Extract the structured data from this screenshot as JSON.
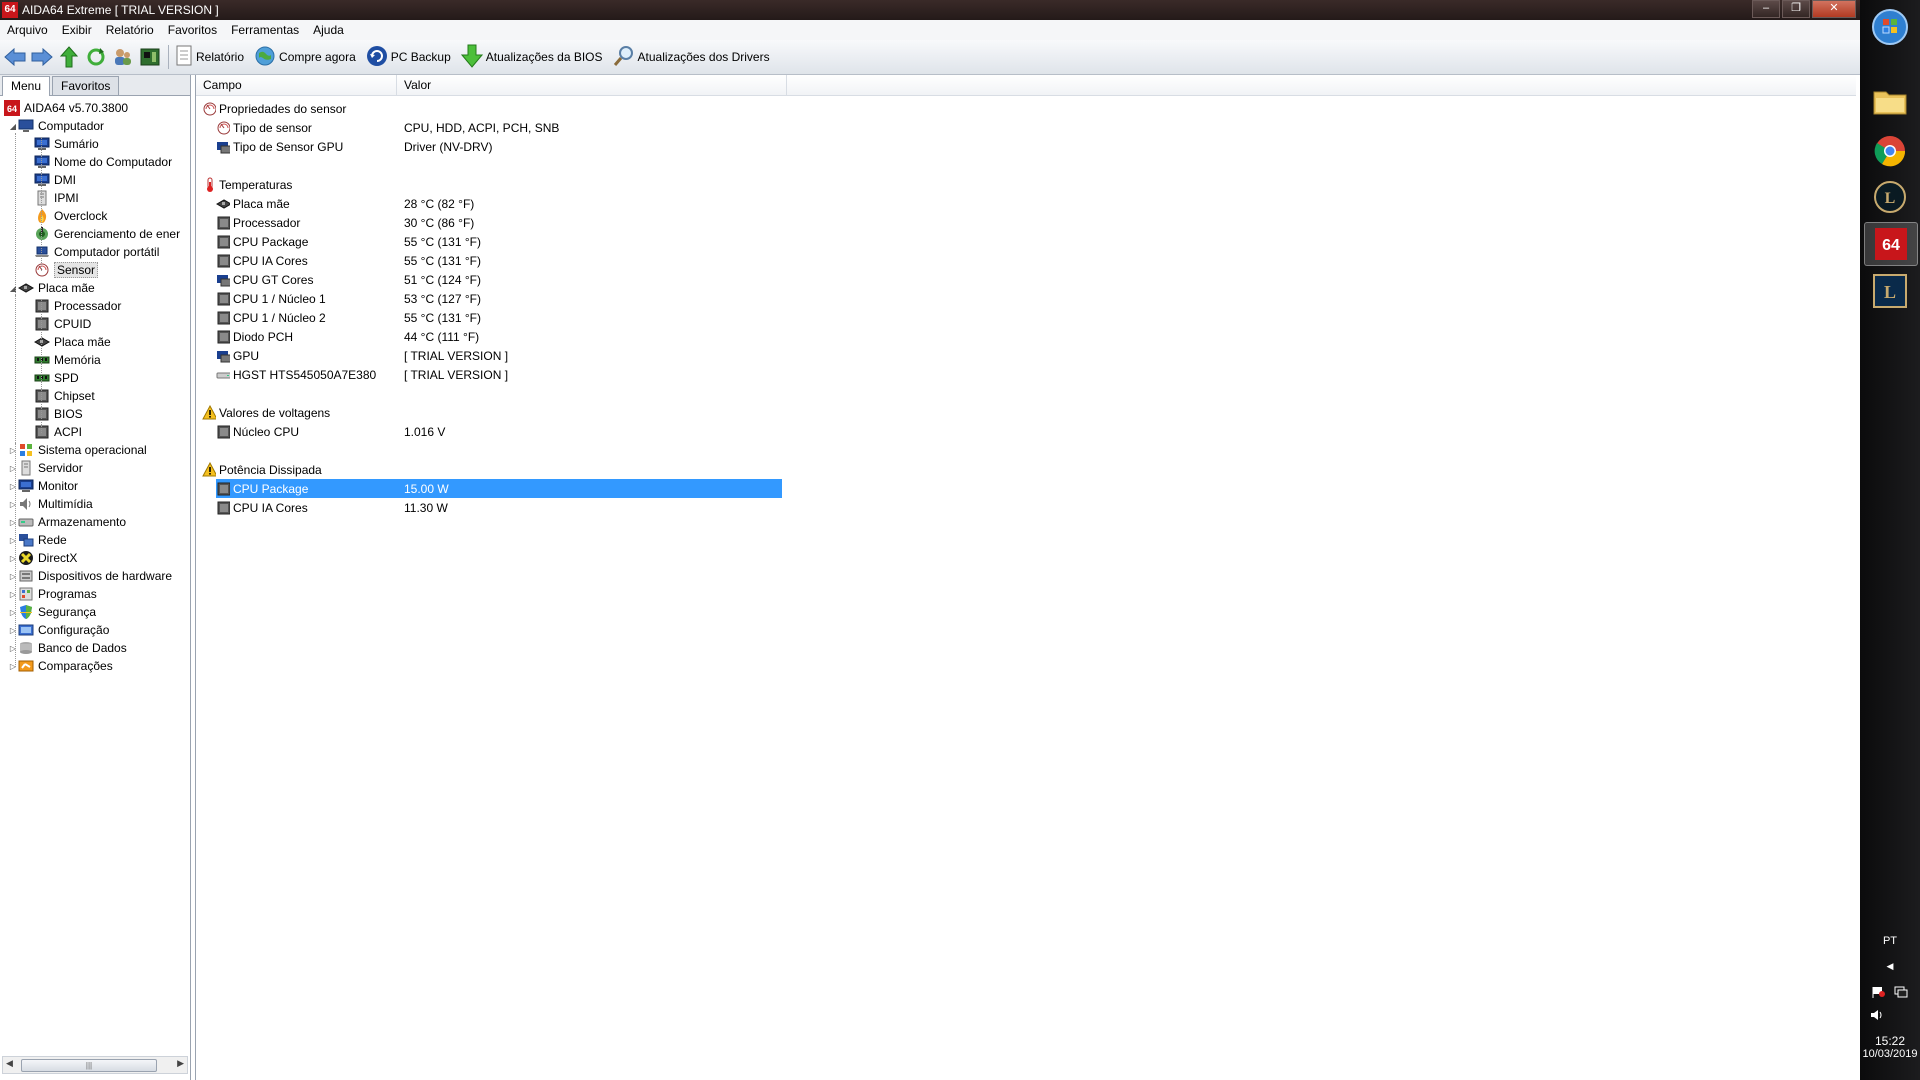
{
  "window": {
    "title": "AIDA64 Extreme  [ TRIAL VERSION ]",
    "app_icon_text": "64",
    "buttons": [
      "–",
      "❐",
      "✕"
    ]
  },
  "menubar": [
    "Arquivo",
    "Exibir",
    "Relatório",
    "Favoritos",
    "Ferramentas",
    "Ajuda"
  ],
  "toolbar": {
    "buttons": [
      {
        "label": "Relatório",
        "icon": "report-icon"
      },
      {
        "label": "Compre agora",
        "icon": "globe-icon"
      },
      {
        "label": "PC Backup",
        "icon": "backup-icon"
      },
      {
        "label": "Atualizações da BIOS",
        "icon": "download-arrow-icon"
      },
      {
        "label": "Atualizações dos Drivers",
        "icon": "magnifier-icon"
      }
    ]
  },
  "left_panel": {
    "tabs": [
      "Menu",
      "Favoritos"
    ],
    "tree": [
      {
        "label": "AIDA64 v5.70.3800",
        "icon": "aida64-icon",
        "level": 0
      },
      {
        "label": "Computador",
        "icon": "computer-icon",
        "level": 1,
        "expander": "◢"
      },
      {
        "label": "Sumário",
        "icon": "monitor-icon",
        "level": 2
      },
      {
        "label": "Nome do Computador",
        "icon": "monitor-icon",
        "level": 2
      },
      {
        "label": "DMI",
        "icon": "monitor-icon",
        "level": 2
      },
      {
        "label": "IPMI",
        "icon": "server-icon",
        "level": 2
      },
      {
        "label": "Overclock",
        "icon": "flame-icon",
        "level": 2
      },
      {
        "label": "Gerenciamento de ener",
        "icon": "power-icon",
        "level": 2
      },
      {
        "label": "Computador portátil",
        "icon": "laptop-icon",
        "level": 2
      },
      {
        "label": "Sensor",
        "icon": "sensor-icon",
        "level": 2,
        "selected": true
      },
      {
        "label": "Placa mãe",
        "icon": "motherboard-icon",
        "level": 1,
        "expander": "◢"
      },
      {
        "label": "Processador",
        "icon": "chip-icon",
        "level": 2
      },
      {
        "label": "CPUID",
        "icon": "chip-icon",
        "level": 2
      },
      {
        "label": "Placa mãe",
        "icon": "motherboard-icon",
        "level": 2
      },
      {
        "label": "Memória",
        "icon": "memory-icon",
        "level": 2
      },
      {
        "label": "SPD",
        "icon": "memory-icon",
        "level": 2
      },
      {
        "label": "Chipset",
        "icon": "chip-icon",
        "level": 2
      },
      {
        "label": "BIOS",
        "icon": "chip-icon",
        "level": 2
      },
      {
        "label": "ACPI",
        "icon": "chip-icon",
        "level": 2
      },
      {
        "label": "Sistema operacional",
        "icon": "windows-icon",
        "level": 1,
        "expander": "▷"
      },
      {
        "label": "Servidor",
        "icon": "server-icon",
        "level": 1,
        "expander": "▷"
      },
      {
        "label": "Monitor",
        "icon": "monitor-icon",
        "level": 1,
        "expander": "▷"
      },
      {
        "label": "Multimídia",
        "icon": "speaker-icon",
        "level": 1,
        "expander": "▷"
      },
      {
        "label": "Armazenamento",
        "icon": "storage-icon",
        "level": 1,
        "expander": "▷"
      },
      {
        "label": "Rede",
        "icon": "network-icon",
        "level": 1,
        "expander": "▷"
      },
      {
        "label": "DirectX",
        "icon": "directx-icon",
        "level": 1,
        "expander": "▷"
      },
      {
        "label": "Dispositivos de hardware",
        "icon": "devices-icon",
        "level": 1,
        "expander": "▷"
      },
      {
        "label": "Programas",
        "icon": "programs-icon",
        "level": 1,
        "expander": "▷"
      },
      {
        "label": "Segurança",
        "icon": "shield-icon",
        "level": 1,
        "expander": "▷"
      },
      {
        "label": "Configuração",
        "icon": "config-icon",
        "level": 1,
        "expander": "▷"
      },
      {
        "label": "Banco de Dados",
        "icon": "database-icon",
        "level": 1,
        "expander": "▷"
      },
      {
        "label": "Comparações",
        "icon": "benchmark-icon",
        "level": 1,
        "expander": "▷"
      }
    ]
  },
  "right_panel": {
    "columns": [
      "Campo",
      "Valor"
    ],
    "rows": [
      {
        "type": "group",
        "field": "Propriedades do sensor",
        "icon": "sensor-icon"
      },
      {
        "type": "item",
        "field": "Tipo de sensor",
        "value": "CPU, HDD, ACPI, PCH, SNB",
        "icon": "sensor-icon"
      },
      {
        "type": "item",
        "field": "Tipo de Sensor GPU",
        "value": "Driver  (NV-DRV)",
        "icon": "gpu-icon"
      },
      {
        "type": "spacer"
      },
      {
        "type": "group",
        "field": "Temperaturas",
        "icon": "thermometer-icon"
      },
      {
        "type": "item",
        "field": "Placa mãe",
        "value": "28 °C  (82 °F)",
        "icon": "motherboard-icon"
      },
      {
        "type": "item",
        "field": "Processador",
        "value": "30 °C  (86 °F)",
        "icon": "chip-icon"
      },
      {
        "type": "item",
        "field": "CPU Package",
        "value": "55 °C  (131 °F)",
        "icon": "chip-icon"
      },
      {
        "type": "item",
        "field": "CPU IA Cores",
        "value": "55 °C  (131 °F)",
        "icon": "chip-icon"
      },
      {
        "type": "item",
        "field": "CPU GT Cores",
        "value": "51 °C  (124 °F)",
        "icon": "gpu-icon"
      },
      {
        "type": "item",
        "field": "CPU 1 / Núcleo 1",
        "value": "53 °C  (127 °F)",
        "icon": "chip-icon"
      },
      {
        "type": "item",
        "field": "CPU 1 / Núcleo 2",
        "value": "55 °C  (131 °F)",
        "icon": "chip-icon"
      },
      {
        "type": "item",
        "field": "Diodo PCH",
        "value": "44 °C  (111 °F)",
        "icon": "chip-icon"
      },
      {
        "type": "item",
        "field": "GPU",
        "value": "[ TRIAL VERSION ]",
        "icon": "gpu-icon"
      },
      {
        "type": "item",
        "field": "HGST HTS545050A7E380",
        "value": "[ TRIAL VERSION ]",
        "icon": "hdd-icon"
      },
      {
        "type": "spacer"
      },
      {
        "type": "group",
        "field": "Valores de voltagens",
        "icon": "warning-icon"
      },
      {
        "type": "item",
        "field": "Núcleo CPU",
        "value": "1.016 V",
        "icon": "chip-icon"
      },
      {
        "type": "spacer"
      },
      {
        "type": "group",
        "field": "Potência Dissipada",
        "icon": "warning-icon"
      },
      {
        "type": "item",
        "field": "CPU Package",
        "value": "15.00 W",
        "icon": "chip-icon",
        "selected": true
      },
      {
        "type": "item",
        "field": "CPU IA Cores",
        "value": "11.30 W",
        "icon": "chip-icon"
      }
    ]
  },
  "taskbar": {
    "apps": [
      {
        "name": "start-orb-icon"
      },
      {
        "name": "folder-icon"
      },
      {
        "name": "chrome-icon"
      },
      {
        "name": "league-client-icon"
      },
      {
        "name": "aida64-taskbar-icon",
        "label": "64",
        "active": true
      },
      {
        "name": "league-l-icon",
        "label": "L"
      }
    ],
    "language": "PT",
    "time": "15:22",
    "date": "10/03/2019"
  },
  "colors": {
    "selection": "#3399ff",
    "title_bar": "#2d2120",
    "aida_red": "#c8161b"
  }
}
